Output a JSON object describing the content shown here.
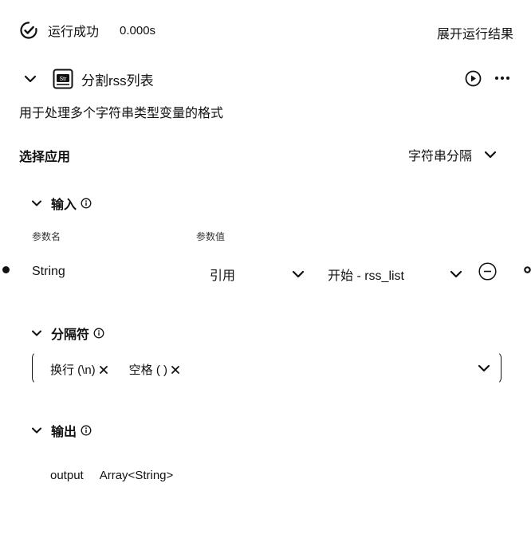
{
  "status": {
    "label": "运行成功",
    "time": "0.000s",
    "expand_label": "展开运行结果"
  },
  "node": {
    "title": "分割rss列表",
    "description": "用于处理多个字符串类型变量的格式"
  },
  "app_select": {
    "label": "选择应用",
    "value": "字符串分隔"
  },
  "input": {
    "section_label": "输入",
    "param_name_header": "参数名",
    "param_value_header": "参数值",
    "rows": [
      {
        "name": "String",
        "type": "引用",
        "value": "开始 - rss_list"
      }
    ]
  },
  "separator": {
    "section_label": "分隔符",
    "tags": [
      {
        "label": "换行 (\\n)"
      },
      {
        "label": "空格 ( )"
      }
    ]
  },
  "output": {
    "section_label": "输出",
    "rows": [
      {
        "name": "output",
        "type": "Array<String>"
      }
    ]
  },
  "icons": {
    "success": "check-circle-icon",
    "collapse": "chevron-down-icon",
    "node": "str-icon",
    "run": "play-circle-icon",
    "more": "more-icon",
    "info": "info-icon",
    "remove": "minus-circle-icon",
    "tag_remove": "close-icon"
  }
}
